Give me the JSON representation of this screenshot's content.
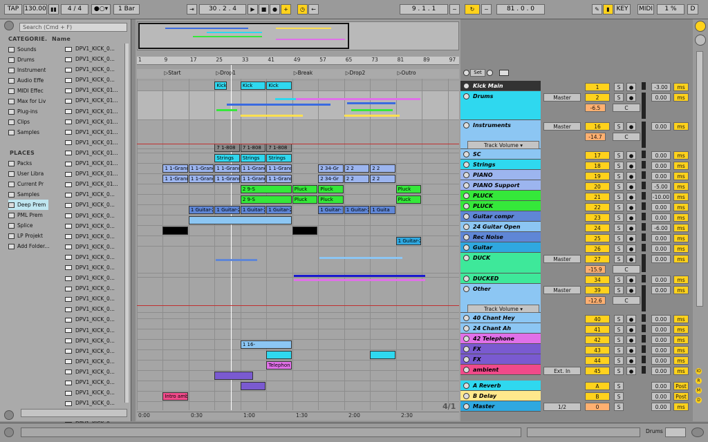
{
  "transport": {
    "tap": "TAP",
    "tempo": "130.00",
    "meter": "4 / 4",
    "quant": "1 Bar",
    "position": "30 .  2 .  4",
    "loop_start": "9 .  1 .  1",
    "loop_length": "81 .  0 .  0",
    "key": "KEY",
    "midi": "MIDI",
    "cpu": "1 %",
    "disk": "D"
  },
  "browser": {
    "search_placeholder": "Search (Cmd + F)",
    "categories_title": "CATEGORIE.",
    "name_col": "Name",
    "categories": [
      "Sounds",
      "Drums",
      "Instrument",
      "Audio Effe",
      "MIDI Effec",
      "Max for Liv",
      "Plug-ins",
      "Clips",
      "Samples"
    ],
    "places_title": "PLACES",
    "places": [
      "Packs",
      "User Libra",
      "Current Pr",
      "Samples",
      "Deep Prem",
      "PML Prem",
      "Splice",
      "LP Projekt",
      "Add Folder..."
    ],
    "files": [
      "DPV1_KICK_0...",
      "DPV1_KICK_0...",
      "DPV1_KICK_0...",
      "DPV1_KICK_0...",
      "DPV1_KICK_01...",
      "DPV1_KICK_01...",
      "DPV1_KICK_01...",
      "DPV1_KICK_01...",
      "DPV1_KICK_01...",
      "DPV1_KICK_01...",
      "DPV1_KICK_01...",
      "DPV1_KICK_01...",
      "DPV1_KICK_01...",
      "DPV1_KICK_01...",
      "DPV1_KICK_0...",
      "DPV1_KICK_0...",
      "DPV1_KICK_0...",
      "DPV1_KICK_0...",
      "DPV1_KICK_0...",
      "DPV1_KICK_0...",
      "DPV1_KICK_0...",
      "DPV1_KICK_0...",
      "DPV1_KICK_0...",
      "DPV1_KICK_0...",
      "DPV1_KICK_0...",
      "DPV1_KICK_0...",
      "DPV1_KICK_0...",
      "DPV1_KICK_0...",
      "DPV1_KICK_0...",
      "DPV1_KICK_0...",
      "DPV1_KICK_0...",
      "DPV1_KICK_0...",
      "DPV1_KICK_0...",
      "DPV1_KICK_0...",
      "DPV1_KICK_0...",
      "DPV1_KICK_0...",
      "DPV1_KICK_0..."
    ]
  },
  "ruler": [
    "1",
    "9",
    "17",
    "25",
    "33",
    "41",
    "49",
    "57",
    "65",
    "73",
    "81",
    "89",
    "97"
  ],
  "locators": [
    "Start",
    "Drop1",
    "Break",
    "Drop2",
    "Outro"
  ],
  "set_label": "Set",
  "time_axis": [
    "0:00",
    "0:30",
    "1:00",
    "1:30",
    "2:00",
    "2:30"
  ],
  "zoom_label": "4/1",
  "tracks": [
    {
      "name": "Kick Main",
      "color": "#333333",
      "no": "1",
      "vol": "-3.00",
      "unit": "ms"
    },
    {
      "name": "Drums",
      "color": "#2fd8ef",
      "no": "2",
      "vol": "0.00",
      "unit": "ms",
      "route": "Master",
      "gain": "-6.5"
    },
    {
      "name": "Instruments",
      "color": "#8cc6f3",
      "no": "16",
      "vol": "0.00",
      "unit": "ms",
      "route": "Master",
      "gain": "-14.7",
      "auto": "Track Volume"
    },
    {
      "name": "SC",
      "color": "#8cc6f3",
      "no": "17",
      "vol": "0.00",
      "unit": "ms"
    },
    {
      "name": "Strings",
      "color": "#2fd8ef",
      "no": "18",
      "vol": "0.00",
      "unit": "ms"
    },
    {
      "name": "PIANO",
      "color": "#9cb5ef",
      "no": "19",
      "vol": "0.00",
      "unit": "ms"
    },
    {
      "name": "PIANO Support",
      "color": "#9cb5ef",
      "no": "20",
      "vol": "-5.00",
      "unit": "ms"
    },
    {
      "name": "PLUCK",
      "color": "#35e83a",
      "no": "21",
      "vol": "-10.00",
      "unit": "ms"
    },
    {
      "name": "PLUCK",
      "color": "#35e83a",
      "no": "22",
      "vol": "0.00",
      "unit": "ms"
    },
    {
      "name": "Guitar compr",
      "color": "#5f86d6",
      "no": "23",
      "vol": "0.00",
      "unit": "ms"
    },
    {
      "name": "24 Guitar Open",
      "color": "#8cc6f3",
      "no": "24",
      "vol": "-6.00",
      "unit": "ms"
    },
    {
      "name": "Rec Noise",
      "color": "#5f86d6",
      "no": "25",
      "vol": "0.00",
      "unit": "ms"
    },
    {
      "name": "Guitar",
      "color": "#2fa8e0",
      "no": "26",
      "vol": "0.00",
      "unit": "ms"
    },
    {
      "name": "DUCK",
      "color": "#3ee89a",
      "no": "27",
      "vol": "0.00",
      "unit": "ms",
      "route": "Master",
      "gain": "-15.9"
    },
    {
      "name": "DUCKED",
      "color": "#3ee89a",
      "no": "34",
      "vol": "0.00",
      "unit": "ms"
    },
    {
      "name": "Other",
      "color": "#8cc6f3",
      "no": "39",
      "vol": "0.00",
      "unit": "ms",
      "route": "Master",
      "gain": "-12.6",
      "auto": "Track Volume"
    },
    {
      "name": "40 Chant Hey",
      "color": "#8cc6f3",
      "no": "40",
      "vol": "0.00",
      "unit": "ms"
    },
    {
      "name": "24 Chant Ah",
      "color": "#8cc6f3",
      "no": "41",
      "vol": "0.00",
      "unit": "ms"
    },
    {
      "name": "42 Telephone",
      "color": "#e070e8",
      "no": "42",
      "vol": "0.00",
      "unit": "ms"
    },
    {
      "name": "FX",
      "color": "#7a5ad0",
      "no": "43",
      "vol": "0.00",
      "unit": "ms"
    },
    {
      "name": "FX",
      "color": "#7a5ad0",
      "no": "44",
      "vol": "0.00",
      "unit": "ms"
    },
    {
      "name": "ambient",
      "color": "#f04a8a",
      "no": "45",
      "vol": "0.00",
      "unit": "ms",
      "route": "Ext. In"
    }
  ],
  "returns": [
    {
      "name": "A Reverb",
      "color": "#2fd8ef",
      "no": "A",
      "vol": "0.00",
      "unit": "Post"
    },
    {
      "name": "B Delay",
      "color": "#ffe88c",
      "no": "B",
      "vol": "0.00",
      "unit": "Post"
    },
    {
      "name": "Master",
      "color": "#2fa8e0",
      "no": "0",
      "vol": "0.00",
      "unit": "ms",
      "route": "1/2"
    }
  ],
  "clips": [
    {
      "row": 0,
      "label": "Kick",
      "start": 25,
      "len": 4,
      "color": "#2fd8ef"
    },
    {
      "row": 0,
      "label": "Kick",
      "start": 33,
      "len": 8,
      "color": "#2fd8ef"
    },
    {
      "row": 0,
      "label": "Kick",
      "start": 41,
      "len": 8,
      "color": "#2fd8ef"
    },
    {
      "row": 6,
      "label": "7 1-808",
      "start": 25,
      "len": 8,
      "color": "#888888"
    },
    {
      "row": 6,
      "label": "7 1-808",
      "start": 33,
      "len": 8,
      "color": "#888888"
    },
    {
      "row": 6,
      "label": "7 1-808",
      "start": 41,
      "len": 8,
      "color": "#888888"
    },
    {
      "row": 7,
      "label": "Strings",
      "start": 25,
      "len": 8,
      "color": "#2fd8ef"
    },
    {
      "row": 7,
      "label": "Strings",
      "start": 33,
      "len": 8,
      "color": "#2fd8ef"
    },
    {
      "row": 7,
      "label": "Strings",
      "start": 41,
      "len": 8,
      "color": "#2fd8ef"
    },
    {
      "row": 8,
      "label": "1 1-Grand",
      "start": 9,
      "len": 8,
      "color": "#9cb5ef"
    },
    {
      "row": 8,
      "label": "1 1-Grand",
      "start": 17,
      "len": 8,
      "color": "#9cb5ef"
    },
    {
      "row": 8,
      "label": "1 1-Grand",
      "start": 25,
      "len": 8,
      "color": "#9cb5ef"
    },
    {
      "row": 8,
      "label": "1 1-Grand",
      "start": 33,
      "len": 8,
      "color": "#9cb5ef"
    },
    {
      "row": 8,
      "label": "1 1-Grand",
      "start": 41,
      "len": 8,
      "color": "#9cb5ef"
    },
    {
      "row": 8,
      "label": "2 34-Gr",
      "start": 57,
      "len": 8,
      "color": "#9cb5ef"
    },
    {
      "row": 8,
      "label": "2 2",
      "start": 65,
      "len": 8,
      "color": "#9cb5ef"
    },
    {
      "row": 8,
      "label": "2 2",
      "start": 73,
      "len": 8,
      "color": "#9cb5ef"
    },
    {
      "row": 9,
      "label": "1 1-Grand",
      "start": 9,
      "len": 8,
      "color": "#9cb5ef"
    },
    {
      "row": 9,
      "label": "1 1-Grand",
      "start": 17,
      "len": 8,
      "color": "#9cb5ef"
    },
    {
      "row": 9,
      "label": "1 1-Grand",
      "start": 25,
      "len": 8,
      "color": "#9cb5ef"
    },
    {
      "row": 9,
      "label": "1 1-Grand",
      "start": 33,
      "len": 8,
      "color": "#9cb5ef"
    },
    {
      "row": 9,
      "label": "1 1-Grand",
      "start": 41,
      "len": 8,
      "color": "#9cb5ef"
    },
    {
      "row": 9,
      "label": "2 34-Gr",
      "start": 57,
      "len": 8,
      "color": "#9cb5ef"
    },
    {
      "row": 9,
      "label": "2 2",
      "start": 65,
      "len": 8,
      "color": "#9cb5ef"
    },
    {
      "row": 9,
      "label": "2 2",
      "start": 73,
      "len": 8,
      "color": "#9cb5ef"
    },
    {
      "row": 10,
      "label": "2 9-S",
      "start": 33,
      "len": 16,
      "color": "#35e83a"
    },
    {
      "row": 10,
      "label": "Pluck",
      "start": 49,
      "len": 8,
      "color": "#35e83a"
    },
    {
      "row": 10,
      "label": "Pluck",
      "start": 57,
      "len": 8,
      "color": "#35e83a"
    },
    {
      "row": 10,
      "label": "Pluck",
      "start": 81,
      "len": 8,
      "color": "#35e83a"
    },
    {
      "row": 11,
      "label": "2 9-S",
      "start": 33,
      "len": 16,
      "color": "#35e83a"
    },
    {
      "row": 11,
      "label": "Pluck",
      "start": 49,
      "len": 8,
      "color": "#35e83a"
    },
    {
      "row": 11,
      "label": "Pluck",
      "start": 57,
      "len": 8,
      "color": "#35e83a"
    },
    {
      "row": 11,
      "label": "Pluck",
      "start": 81,
      "len": 8,
      "color": "#35e83a"
    },
    {
      "row": 12,
      "label": "1 Guitar-2",
      "start": 17,
      "len": 8,
      "color": "#5f86d6"
    },
    {
      "row": 12,
      "label": "1 Guitar-2",
      "start": 25,
      "len": 8,
      "color": "#5f86d6"
    },
    {
      "row": 12,
      "label": "1 Guitar-2",
      "start": 33,
      "len": 8,
      "color": "#5f86d6"
    },
    {
      "row": 12,
      "label": "1 Guitar-2",
      "start": 41,
      "len": 8,
      "color": "#5f86d6"
    },
    {
      "row": 12,
      "label": "1 Guitar-",
      "start": 57,
      "len": 8,
      "color": "#5f86d6"
    },
    {
      "row": 12,
      "label": "1 Guitar-2",
      "start": 65,
      "len": 8,
      "color": "#5f86d6"
    },
    {
      "row": 12,
      "label": "1 Guita",
      "start": 73,
      "len": 8,
      "color": "#5f86d6"
    },
    {
      "row": 13,
      "label": "",
      "start": 17,
      "len": 32,
      "color": "#8cc6f3"
    },
    {
      "row": 14,
      "label": "",
      "start": 9,
      "len": 8,
      "color": "#000000"
    },
    {
      "row": 14,
      "label": "",
      "start": 49,
      "len": 8,
      "color": "#000000"
    },
    {
      "row": 15,
      "label": "1 Guitar-2",
      "start": 81,
      "len": 8,
      "color": "#2fa8e0"
    },
    {
      "row": 25,
      "label": "1 16-",
      "start": 33,
      "len": 16,
      "color": "#8cc6f3"
    },
    {
      "row": 26,
      "label": "",
      "start": 41,
      "len": 8,
      "color": "#2fd8ef"
    },
    {
      "row": 26,
      "label": "",
      "start": 73,
      "len": 8,
      "color": "#2fd8ef"
    },
    {
      "row": 27,
      "label": "Telephon",
      "start": 41,
      "len": 8,
      "color": "#e070e8"
    },
    {
      "row": 28,
      "label": "",
      "start": 25,
      "len": 12,
      "color": "#7a5ad0"
    },
    {
      "row": 29,
      "label": "",
      "start": 33,
      "len": 8,
      "color": "#7a5ad0"
    },
    {
      "row": 30,
      "label": "Intro amb",
      "start": 9,
      "len": 8,
      "color": "#f04a8a"
    }
  ],
  "status": {
    "drums_label": "Drums"
  }
}
